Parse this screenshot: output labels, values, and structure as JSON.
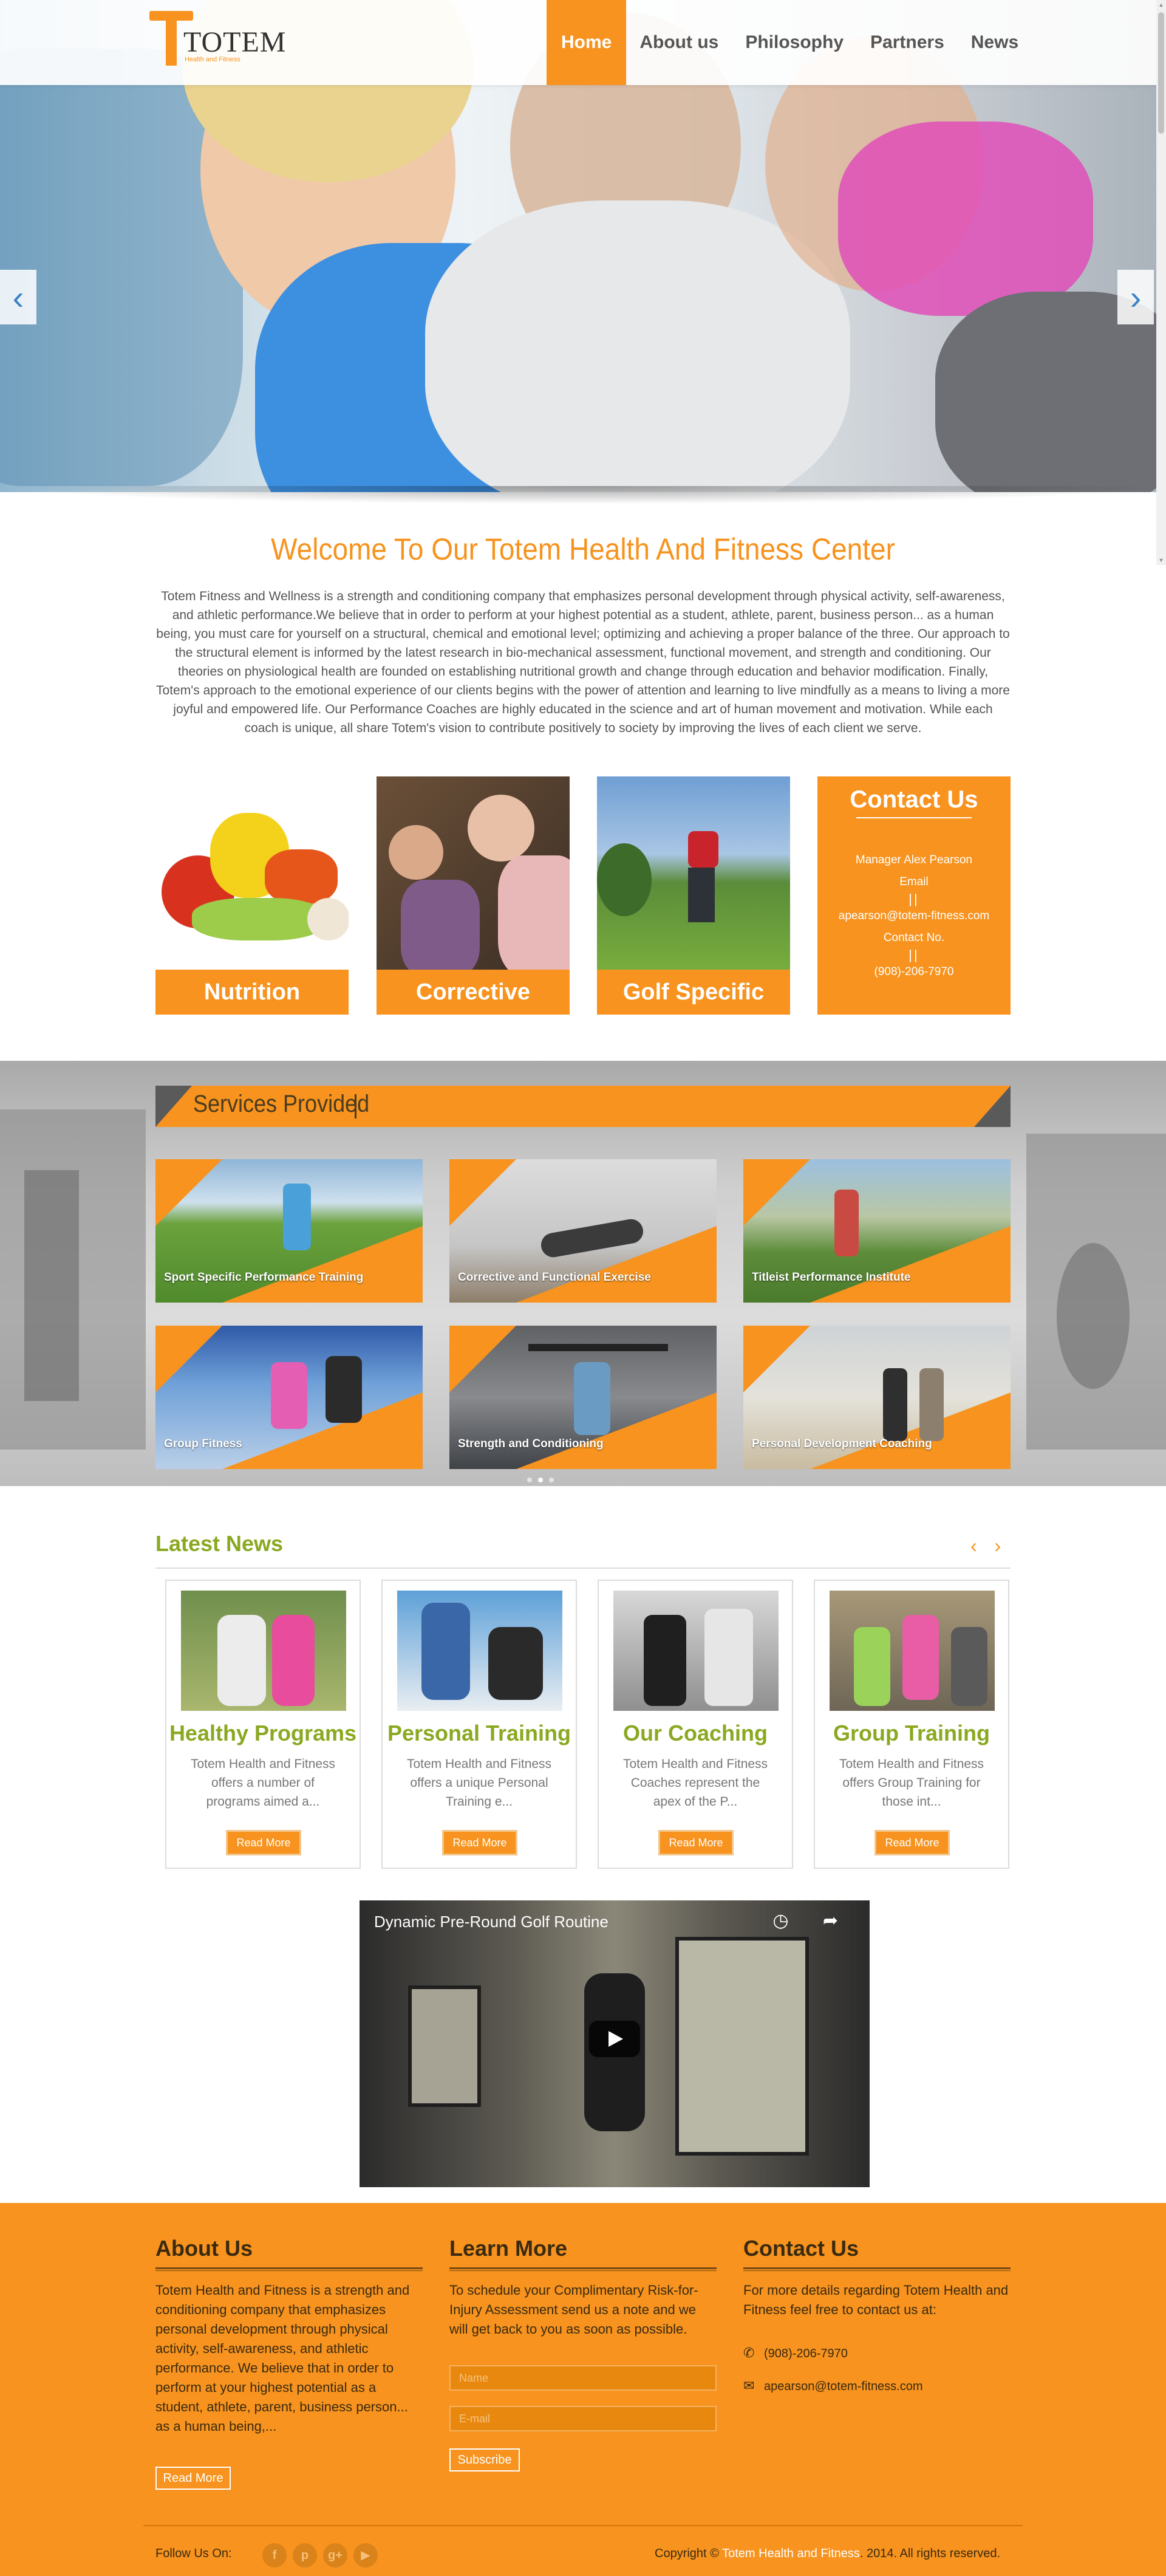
{
  "header": {
    "logo_word": "TOTEM",
    "logo_sub": "Health and Fitness",
    "nav": [
      {
        "label": "Home",
        "active": true
      },
      {
        "label": "About us",
        "active": false
      },
      {
        "label": "Philosophy",
        "active": false
      },
      {
        "label": "Partners",
        "active": false
      },
      {
        "label": "News",
        "active": false
      }
    ]
  },
  "hero": {
    "prev_icon": "‹",
    "next_icon": "›"
  },
  "welcome": {
    "title": "Welcome To Our Totem Health And Fitness Center",
    "text": "Totem Fitness and Wellness is a strength and conditioning company that emphasizes personal development through physical activity, self-awareness, and athletic performance.We believe that in order to perform at your highest potential as a student, athlete, parent, business person... as a human being, you must care for yourself on a structural, chemical and emotional level; optimizing and achieving a proper balance of the three. Our approach to the structural element is informed by the latest research in bio-mechanical assessment, functional movement, and strength and conditioning. Our theories on physiological health are founded on establishing nutritional growth and change through education and behavior modification. Finally, Totem's approach to the emotional experience of our clients begins with the power of attention and learning to live mindfully as a means to living a more joyful and empowered life. Our Performance Coaches are highly educated in the science and art of human movement and motivation. While each coach is unique, all share Totem's vision to contribute positively to society by improving the lives of each client we serve."
  },
  "features": [
    {
      "label": "Nutrition"
    },
    {
      "label": "Corrective Exercise"
    },
    {
      "label": "Golf Specific"
    }
  ],
  "contact_card": {
    "title": "Contact Us",
    "manager": "Manager Alex Pearson",
    "email_label": "Email",
    "separator": "||",
    "email": "apearson@totem-fitness.com",
    "phone_label": "Contact No.",
    "phone": "(908)-206-7970"
  },
  "services": {
    "title": "Services Provided",
    "items": [
      {
        "label": "Sport Specific Performance Training"
      },
      {
        "label": "Corrective and Functional Exercise"
      },
      {
        "label": "Titleist Performance Institute"
      },
      {
        "label": "Group Fitness"
      },
      {
        "label": "Strength and Conditioning"
      },
      {
        "label": "Personal Development Coaching"
      }
    ]
  },
  "news": {
    "title": "Latest News",
    "arrows": "‹ ›",
    "items": [
      {
        "title": "Healthy Programs",
        "text": "Totem Health and Fitness offers a number of programs aimed a...",
        "button": "Read More"
      },
      {
        "title": "Personal Training",
        "text": "Totem Health and Fitness offers a unique Personal Training e...",
        "button": "Read More"
      },
      {
        "title": "Our Coaching",
        "text": "Totem Health and Fitness Coaches represent the apex of the P...",
        "button": "Read More"
      },
      {
        "title": "Group Training",
        "text": "Totem Health and Fitness offers Group Training for those int...",
        "button": "Read More"
      }
    ]
  },
  "video": {
    "title": "Dynamic Pre-Round Golf Routine",
    "icons": "◷ ➦"
  },
  "footer": {
    "about": {
      "title": "About Us",
      "text": "Totem Health and Fitness is a strength and conditioning company that emphasizes personal development through physical activity, self-awareness, and athletic performance. We believe that in order to perform at your highest potential as a student, athlete, parent, business person... as a human being,...",
      "button": "Read More"
    },
    "learn": {
      "title": "Learn More",
      "text": "To schedule your Complimentary Risk-for-Injury Assessment send us a note and we will get back to you as soon as possible.",
      "name_placeholder": "Name",
      "email_placeholder": "E-mail",
      "button": "Subscribe"
    },
    "contact": {
      "title": "Contact Us",
      "text": "For more details regarding Totem Health and Fitness feel free to contact us at:",
      "phone": "(908)-206-7970",
      "email": "apearson@totem-fitness.com"
    },
    "follow_label": "Follow Us On:",
    "social": [
      "f",
      "p",
      "g+",
      "▶"
    ],
    "copyright_prefix": "Copyright ©",
    "copyright_brand": "Totem Health and Fitness",
    "copyright_suffix": ". 2014. All rights reserved."
  }
}
